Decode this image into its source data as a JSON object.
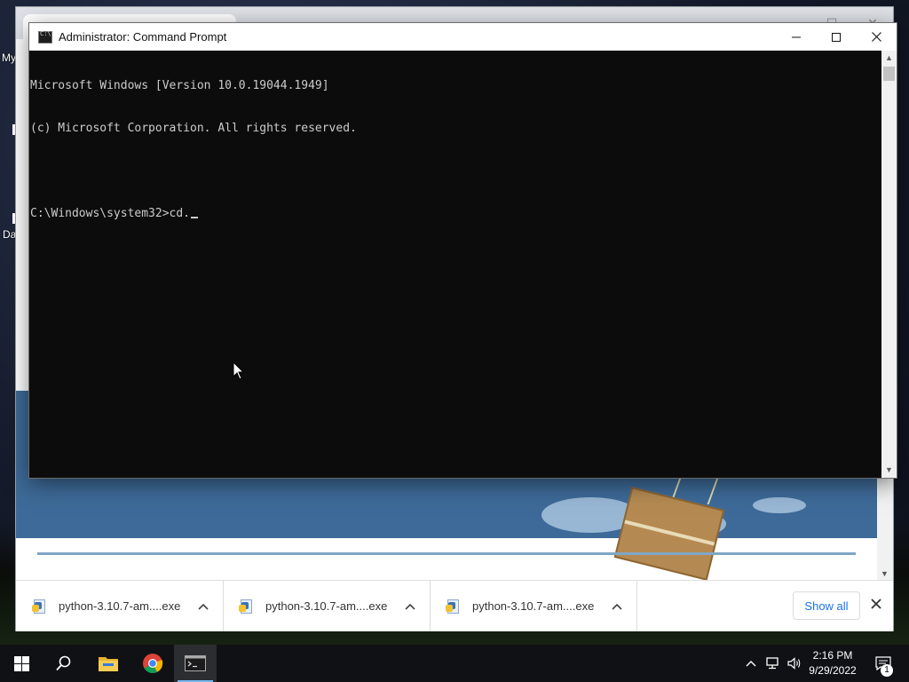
{
  "desktop": {
    "label_top": "My",
    "label_bottom": "Da"
  },
  "cmd_window": {
    "title": "Administrator: Command Prompt",
    "lines": [
      "Microsoft Windows [Version 10.0.19044.1949]",
      "(c) Microsoft Corporation. All rights reserved.",
      "",
      "C:\\Windows\\system32>cd."
    ],
    "background_color": "#0c0c0c",
    "text_color": "#cccccc"
  },
  "downloads_bar": {
    "items": [
      {
        "name": "python-3.10.7-am....exe"
      },
      {
        "name": "python-3.10.7-am....exe"
      },
      {
        "name": "python-3.10.7-am....exe"
      }
    ],
    "show_all_label": "Show all"
  },
  "taskbar": {
    "time": "2:16 PM",
    "date": "9/29/2022",
    "notification_count": "1",
    "apps": [
      "start-icon",
      "search-icon",
      "file-explorer-icon",
      "chrome-icon",
      "command-prompt-icon"
    ],
    "accent_color": "#76b9ed"
  }
}
